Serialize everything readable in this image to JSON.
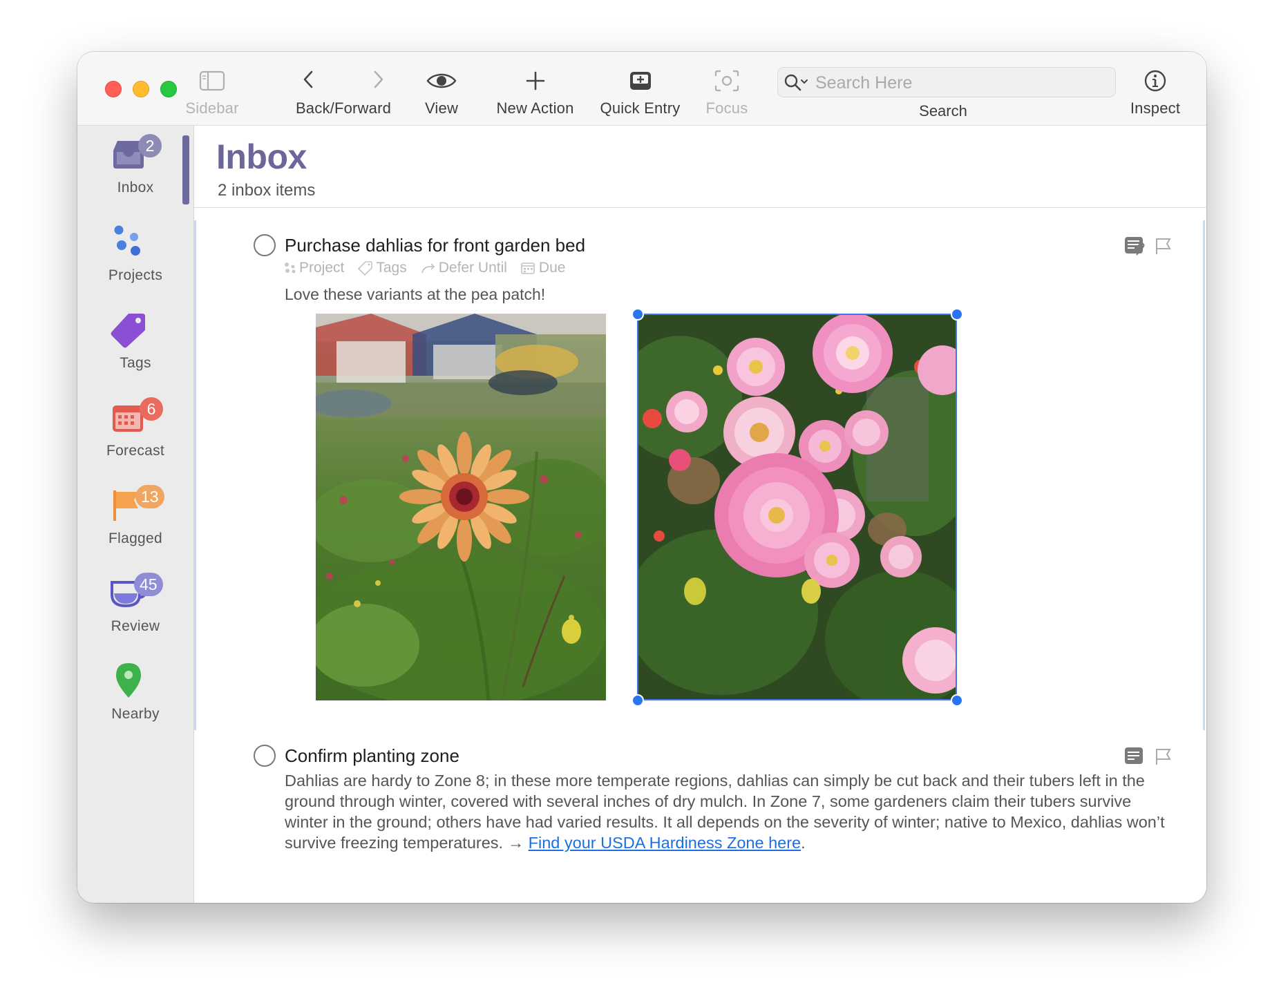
{
  "toolbar": {
    "sidebar_label": "Sidebar",
    "back_forward_label": "Back/Forward",
    "view_label": "View",
    "new_action_label": "New Action",
    "quick_entry_label": "Quick Entry",
    "focus_label": "Focus",
    "search_placeholder": "Search Here",
    "search_label": "Search",
    "inspect_label": "Inspect"
  },
  "sidebar": {
    "items": [
      {
        "label": "Inbox",
        "badge": "2",
        "badge_color": "#8d8bb3",
        "icon": "inbox-tray-icon"
      },
      {
        "label": "Projects",
        "icon": "projects-dots-icon"
      },
      {
        "label": "Tags",
        "icon": "tag-icon"
      },
      {
        "label": "Forecast",
        "badge": "6",
        "badge_color": "#ea6a5e",
        "icon": "calendar-icon"
      },
      {
        "label": "Flagged",
        "badge": "13",
        "badge_color": "#f0a560",
        "icon": "flag-icon"
      },
      {
        "label": "Review",
        "badge": "45",
        "badge_color": "#8f8cd8",
        "icon": "review-cup-icon"
      },
      {
        "label": "Nearby",
        "icon": "location-pin-icon"
      }
    ]
  },
  "header": {
    "title": "Inbox",
    "subtitle": "2 inbox items",
    "title_color": "#6b6899"
  },
  "tasks": [
    {
      "title": "Purchase dahlias for front garden bed",
      "meta": {
        "project": "Project",
        "tags": "Tags",
        "defer": "Defer Until",
        "due": "Due"
      },
      "note": "Love these variants at the pea patch!",
      "images": [
        "dahlia-orange-photo",
        "dahlia-pink-photo"
      ]
    },
    {
      "title": "Confirm planting zone",
      "note": "Dahlias are hardy to Zone 8; in these more temperate regions, dahlias can simply be cut back and their tubers left in the ground through winter, covered with several inches of dry mulch. In Zone 7, some gardeners claim their tubers survive winter in the ground; others have had varied results. It all depends on the severity of winter; native to Mexico, dahlias won’t survive freezing temperatures. →",
      "link_text": "Find your USDA Hardiness Zone here",
      "link_suffix": "."
    }
  ]
}
